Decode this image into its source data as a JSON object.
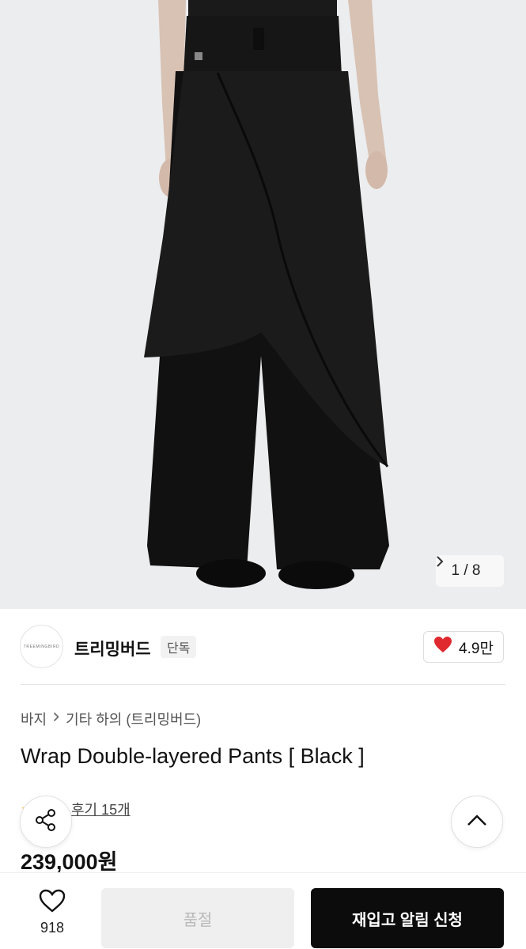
{
  "gallery": {
    "image_alt": "Wrap Double-layered Pants [ Black ] product photo",
    "current": "1",
    "separator": "/",
    "total": "8"
  },
  "brand": {
    "logo_text": "TREEMINGBIRD",
    "name": "트리밍버드",
    "badge": "단독",
    "like_count": "4.9만"
  },
  "breadcrumb": {
    "category": "바지",
    "subcategory": "기타 하의 (트리밍버드)"
  },
  "product": {
    "title": "Wrap Double-layered Pants [ Black ]",
    "review_link": "후기 15개",
    "price": "239,000원"
  },
  "bottom_bar": {
    "wish_count": "918",
    "soldout_label": "품절",
    "restock_label": "재입고 알림 신청"
  },
  "colors": {
    "accent_heart": "#e0282f",
    "primary_button": "#0c0c0c",
    "disabled_button": "#efefef",
    "star": "#f5b31b"
  },
  "icons": {
    "share": "share-icon",
    "heart_filled": "heart-icon",
    "heart_outline": "heart-outline-icon",
    "chevron_up": "chevron-up-icon",
    "chevron_right": "chevron-right-icon",
    "star": "star-icon"
  }
}
